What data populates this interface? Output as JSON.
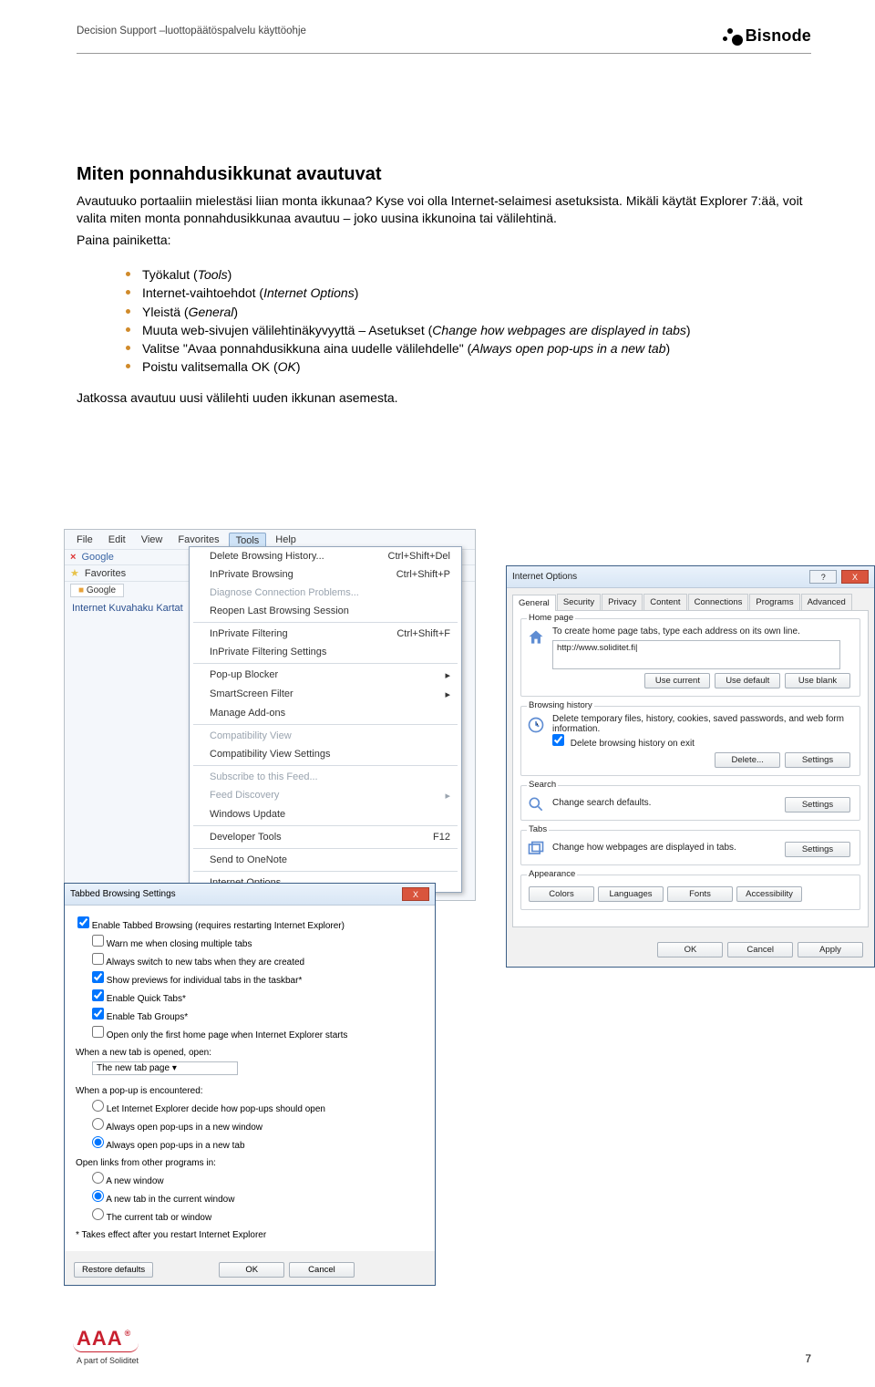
{
  "header": {
    "doc_title": "Decision Support –luottopäätöspalvelu käyttöohje",
    "brand": "Bisnode"
  },
  "main": {
    "heading": "Miten ponnahdusikkunat avautuvat",
    "p1": "Avautuuko portaaliin mielestäsi liian monta ikkunaa? Kyse voi olla Internet-selaimesi asetuksista. Mikäli käytät Explorer 7:ää, voit valita miten monta ponnahdusikkunaa avautuu – joko uusina ikkunoina tai välilehtinä.",
    "p2": "Paina painiketta:",
    "bullets": [
      {
        "pre": "Työkalut (",
        "it": "Tools",
        "post": ")"
      },
      {
        "pre": "Internet-vaihtoehdot (",
        "it": "Internet Options",
        "post": ")"
      },
      {
        "pre": "Yleistä (",
        "it": "General",
        "post": ")"
      },
      {
        "pre": "Muuta web-sivujen välilehtinäkyvyyttä – Asetukset (",
        "it": "Change how webpages are displayed in tabs",
        "post": ")"
      },
      {
        "pre": "Valitse \"Avaa ponnahdusikkuna aina uudelle välilehdelle\" (",
        "it": "Always open pop-ups in a new tab",
        "post": ")"
      },
      {
        "pre": "Poistu valitsemalla OK (",
        "it": "OK",
        "post": ")"
      }
    ],
    "after": "Jatkossa avautuu uusi välilehti uuden ikkunan asemesta."
  },
  "ie_menu": {
    "menubar": [
      "File",
      "Edit",
      "View",
      "Favorites",
      "Tools",
      "Help"
    ],
    "row_google_label": "Google",
    "row_fav_label": "Favorites",
    "row_tab_label": "Google",
    "left_links": "Internet   Kuvahaku   Kartat",
    "items": [
      {
        "label": "Delete Browsing History...",
        "accel": "Ctrl+Shift+Del"
      },
      {
        "label": "InPrivate Browsing",
        "accel": "Ctrl+Shift+P"
      },
      {
        "label": "Diagnose Connection Problems...",
        "disabled": true
      },
      {
        "label": "Reopen Last Browsing Session"
      },
      {
        "sep": true
      },
      {
        "label": "InPrivate Filtering",
        "accel": "Ctrl+Shift+F"
      },
      {
        "label": "InPrivate Filtering Settings"
      },
      {
        "sep": true
      },
      {
        "label": "Pop-up Blocker",
        "sub": true
      },
      {
        "label": "SmartScreen Filter",
        "sub": true
      },
      {
        "label": "Manage Add-ons"
      },
      {
        "sep": true
      },
      {
        "label": "Compatibility View",
        "disabled": true
      },
      {
        "label": "Compatibility View Settings"
      },
      {
        "sep": true
      },
      {
        "label": "Subscribe to this Feed...",
        "disabled": true
      },
      {
        "label": "Feed Discovery",
        "disabled": true,
        "sub": true
      },
      {
        "label": "Windows Update"
      },
      {
        "sep": true
      },
      {
        "label": "Developer Tools",
        "accel": "F12"
      },
      {
        "sep": true
      },
      {
        "label": "Send to OneNote"
      },
      {
        "sep": true
      },
      {
        "label": "Internet Options"
      }
    ]
  },
  "io": {
    "title": "Internet Options",
    "tabs": [
      "General",
      "Security",
      "Privacy",
      "Content",
      "Connections",
      "Programs",
      "Advanced"
    ],
    "home": {
      "legend": "Home page",
      "desc": "To create home page tabs, type each address on its own line.",
      "url": "http://www.soliditet.fi|",
      "btns": [
        "Use current",
        "Use default",
        "Use blank"
      ]
    },
    "history": {
      "legend": "Browsing history",
      "desc": "Delete temporary files, history, cookies, saved passwords, and web form information.",
      "check": "Delete browsing history on exit",
      "btns": [
        "Delete...",
        "Settings"
      ]
    },
    "search": {
      "legend": "Search",
      "desc": "Change search defaults.",
      "btn": "Settings"
    },
    "tabs_section": {
      "legend": "Tabs",
      "desc": "Change how webpages are displayed in tabs.",
      "btn": "Settings"
    },
    "appearance": {
      "legend": "Appearance",
      "btns": [
        "Colors",
        "Languages",
        "Fonts",
        "Accessibility"
      ]
    },
    "footer": [
      "OK",
      "Cancel",
      "Apply"
    ]
  },
  "tbs": {
    "title": "Tabbed Browsing Settings",
    "main_check": "Enable Tabbed Browsing (requires restarting Internet Explorer)",
    "sub_checks": [
      {
        "label": "Warn me when closing multiple tabs",
        "chk": false
      },
      {
        "label": "Always switch to new tabs when they are created",
        "chk": false
      },
      {
        "label": "Show previews for individual tabs in the taskbar*",
        "chk": true
      },
      {
        "label": "Enable Quick Tabs*",
        "chk": true
      },
      {
        "label": "Enable Tab Groups*",
        "chk": true
      },
      {
        "label": "Open only the first home page when Internet Explorer starts",
        "chk": false
      }
    ],
    "newtab_label": "When a new tab is opened, open:",
    "newtab_value": "The new tab page",
    "popup_label": "When a pop-up is encountered:",
    "popup_opts": [
      {
        "label": "Let Internet Explorer decide how pop-ups should open",
        "sel": false
      },
      {
        "label": "Always open pop-ups in a new window",
        "sel": false
      },
      {
        "label": "Always open pop-ups in a new tab",
        "sel": true
      }
    ],
    "other_label": "Open links from other programs in:",
    "other_opts": [
      {
        "label": "A new window",
        "sel": false
      },
      {
        "label": "A new tab in the current window",
        "sel": true
      },
      {
        "label": "The current tab or window",
        "sel": false
      }
    ],
    "note": "* Takes effect after you restart Internet Explorer",
    "footer": {
      "restore": "Restore defaults",
      "ok": "OK",
      "cancel": "Cancel"
    }
  },
  "footer": {
    "aaa": "AAA",
    "aaa_sub": "A part of Soliditet",
    "page": "7"
  }
}
